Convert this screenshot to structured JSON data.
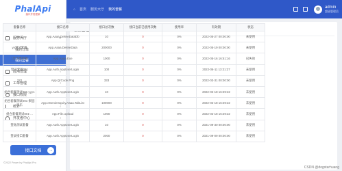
{
  "logo": {
    "text": "PhalApi",
    "sub": "接口开发框架"
  },
  "sidebar": {
    "items": [
      {
        "label": "首页",
        "icon": "home-icon"
      },
      {
        "label": "服务大厅",
        "icon": "service-icon",
        "arrow": "▾"
      },
      {
        "label": "我的订单",
        "sub": true
      },
      {
        "label": "我的套餐",
        "sub": true,
        "active": true
      },
      {
        "label": "应用管理",
        "icon": "app-icon",
        "arrow": "‹"
      },
      {
        "label": "工单管理",
        "icon": "ticket-icon",
        "arrow": "‹"
      },
      {
        "label": "接口权限",
        "icon": "permission-icon"
      },
      {
        "label": "统计",
        "icon": "chart-icon",
        "arrow": "‹"
      },
      {
        "label": "开发者中心",
        "icon": "developer-icon",
        "arrow": "‹"
      }
    ],
    "api_button": "接口文档",
    "api_button_arrow": "→",
    "copyright": "©2022 Power by PhalApi Pro"
  },
  "topbar": {
    "crumbs": [
      "首页",
      "服务大厅",
      "我的套餐"
    ],
    "home_glyph": "⌂",
    "user": "admin",
    "role": "超级管理员"
  },
  "card": {
    "title": "套餐管理"
  },
  "table": {
    "headers": [
      "套餐名称",
      "接口名称",
      "接口总次数",
      "接口当前已使用次数",
      "使用率",
      "有效期",
      "状态"
    ],
    "rows": [
      [
        "xxxx1",
        "App.Aaaa.DeleteDataDb",
        "10",
        "0",
        "0%",
        "2022-05-27 00:00:00",
        "未使用"
      ],
      [
        "yy测试套餐",
        "App.Aaaa.DeleteData",
        "200000",
        "0",
        "0%",
        "2022-05-19 00:00:00",
        "未使用"
      ],
      [
        "1年流量套餐",
        "App.Aaaa.Exe",
        "1000",
        "0",
        "0%",
        "2022-05-16 16:51:16",
        "已失效"
      ],
      [
        "登录套餐001",
        "App.Auth.AppUserLogin",
        "100",
        "0",
        "0%",
        "2022-06-11 13:21:27",
        "未使用"
      ],
      [
        "222",
        "App.QrCode.Png",
        "333",
        "0",
        "0%",
        "2022-03-31 00:00:00",
        "未使用"
      ],
      [
        "组合套餐测试001-yyy1",
        "App.Auth.AppUserLogin",
        "10",
        "0",
        "0%",
        "2022-02-18 16:29:22",
        "未使用"
      ],
      [
        "组合套餐测试001-果园快乐",
        "App.eGenieInquiry.Aaaa.TabList",
        "100000",
        "0",
        "0%",
        "2022-02-18 16:29:22",
        "未使用"
      ],
      [
        "组合套餐测试001-...",
        "App.File.Upload",
        "1000",
        "0",
        "0%",
        "2022-02-18 16:29:22",
        "未使用"
      ],
      [
        "登陆测试套餐",
        "App.Auth.AppUserLogin",
        "10",
        "0",
        "0%",
        "2021-09-30 00:00:00",
        "未使用"
      ],
      [
        "登录接口套餐",
        "App.Auth.AppUserLogin",
        "2000",
        "0",
        "0%",
        "2021-09-09 00:00:00",
        "未使用"
      ]
    ]
  },
  "watermark": "CSDN @dogstarhuang"
}
